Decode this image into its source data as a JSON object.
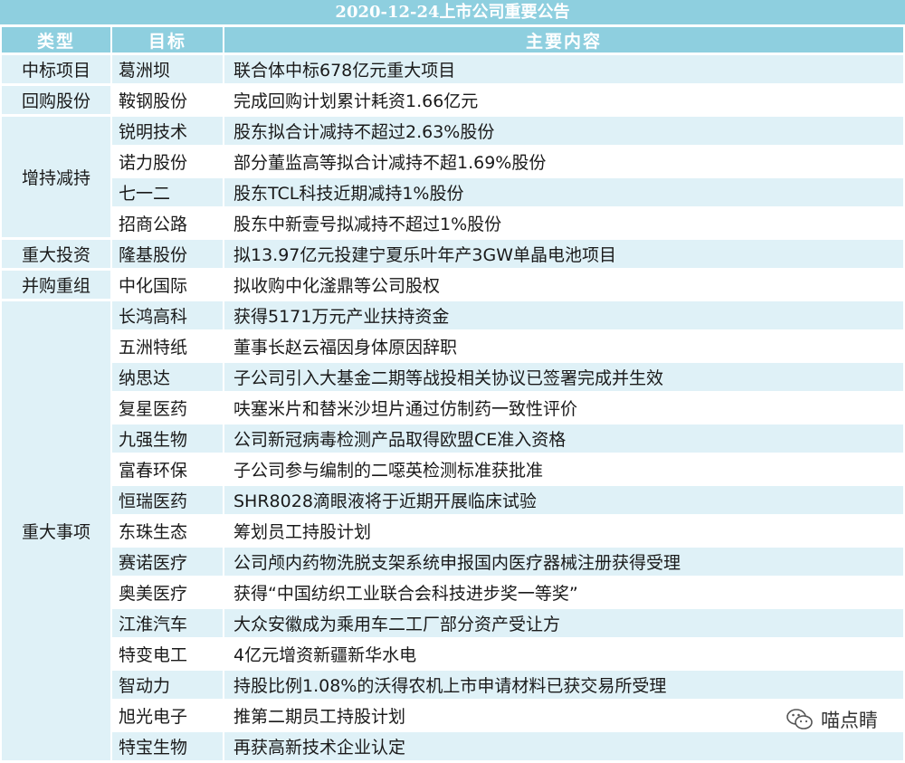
{
  "banner": "2020-12-24上市公司重要公告",
  "headers": [
    "类型",
    "目标",
    "主要内容"
  ],
  "groups": [
    {
      "type": "中标项目",
      "rows": [
        [
          "葛洲坝",
          "联合体中标678亿元重大项目"
        ]
      ]
    },
    {
      "type": "回购股份",
      "rows": [
        [
          "鞍钢股份",
          "完成回购计划累计耗资1.66亿元"
        ]
      ]
    },
    {
      "type": "增持减持",
      "rows": [
        [
          "锐明技术",
          "股东拟合计减持不超过2.63%股份"
        ],
        [
          "诺力股份",
          "部分董监高等拟合计减持不超1.69%股份"
        ],
        [
          "七一二",
          "股东TCL科技近期减持1%股份"
        ],
        [
          "招商公路",
          "股东中新壹号拟减持不超过1%股份"
        ]
      ]
    },
    {
      "type": "重大投资",
      "rows": [
        [
          "隆基股份",
          "拟13.97亿元投建宁夏乐叶年产3GW单晶电池项目"
        ]
      ]
    },
    {
      "type": "并购重组",
      "rows": [
        [
          "中化国际",
          "拟收购中化滏鼎等公司股权"
        ]
      ]
    },
    {
      "type": "重大事项",
      "rows": [
        [
          "长鸿高科",
          "获得5171万元产业扶持资金"
        ],
        [
          "五洲特纸",
          "董事长赵云福因身体原因辞职"
        ],
        [
          "纳思达",
          "子公司引入大基金二期等战投相关协议已签署完成并生效"
        ],
        [
          "复星医药",
          "呋塞米片和替米沙坦片通过仿制药一致性评价"
        ],
        [
          "九强生物",
          "公司新冠病毒检测产品取得欧盟CE准入资格"
        ],
        [
          "富春环保",
          "子公司参与编制的二噁英检测标准获批准"
        ],
        [
          "恒瑞医药",
          "SHR8028滴眼液将于近期开展临床试验"
        ],
        [
          "东珠生态",
          "筹划员工持股计划"
        ],
        [
          "赛诺医疗",
          "公司颅内药物洗脱支架系统申报国内医疗器械注册获得受理"
        ],
        [
          "奥美医疗",
          "获得“中国纺织工业联合会科技进步奖一等奖”"
        ],
        [
          "江淮汽车",
          "大众安徽成为乘用车二工厂部分资产受让方"
        ],
        [
          "特变电工",
          "4亿元增资新疆新华水电"
        ],
        [
          "智动力",
          "持股比例1.08%的沃得农机上市申请材料已获交易所受理"
        ],
        [
          "旭光电子",
          "推第二期员工持股计划"
        ],
        [
          "特宝生物",
          "再获高新技术企业认定"
        ]
      ]
    }
  ],
  "watermark": {
    "text": "喵点睛",
    "icon": "wechat-icon"
  }
}
